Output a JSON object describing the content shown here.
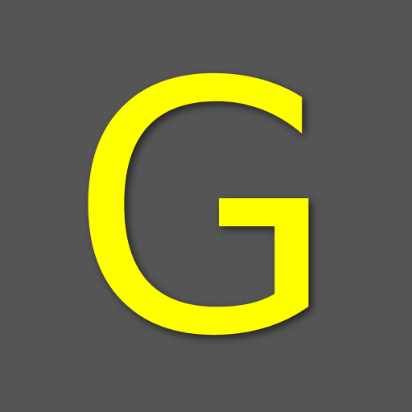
{
  "icon": {
    "letter": "G",
    "background_color": "#555555",
    "letter_color": "#ffff00",
    "shadow_color": "#000000"
  }
}
